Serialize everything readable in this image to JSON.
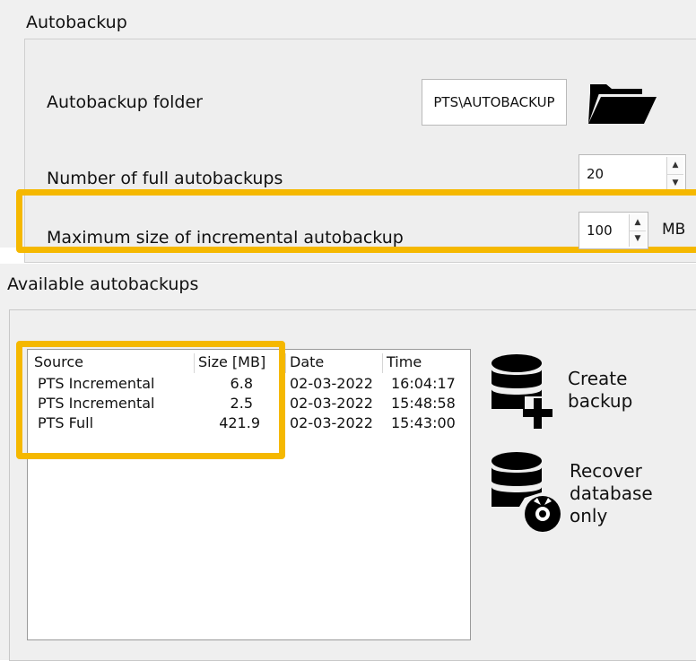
{
  "autobackup": {
    "title": "Autobackup",
    "folder_label": "Autobackup folder",
    "folder_value": "PTS\\AUTOBACKUP",
    "full_count_label": "Number of full autobackups",
    "full_count_value": "20",
    "incremental_label": "Maximum size of incremental autobackup",
    "incremental_value": "100",
    "incremental_unit": "MB"
  },
  "available": {
    "title": "Available autobackups",
    "columns": [
      "Source",
      "Size [MB]",
      "Date",
      "Time"
    ],
    "rows": [
      {
        "source": "PTS Incremental",
        "size": "6.8",
        "date": "02-03-2022",
        "time": "16:04:17"
      },
      {
        "source": "PTS Incremental",
        "size": "2.5",
        "date": "02-03-2022",
        "time": "15:48:58"
      },
      {
        "source": "PTS Full",
        "size": "421.9",
        "date": "02-03-2022",
        "time": "15:43:00"
      }
    ]
  },
  "actions": {
    "create_label": "Create\nbackup",
    "recover_label": "Recover\ndatabase\nonly"
  },
  "colors": {
    "highlight": "#f5b800",
    "panel": "#f0f0f0"
  },
  "icons": {
    "folder": "folder-open-icon",
    "create": "database-add-icon",
    "recover": "database-lifebuoy-icon"
  }
}
